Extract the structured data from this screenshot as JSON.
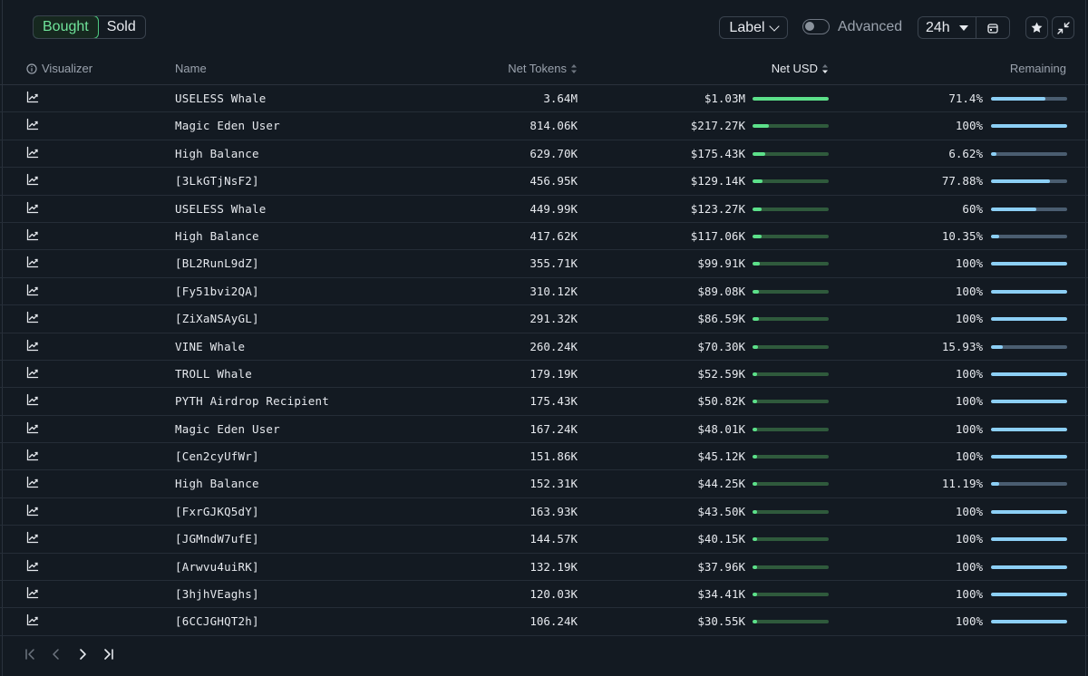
{
  "toolbar": {
    "tabs": [
      {
        "label": "Bought",
        "active": true
      },
      {
        "label": "Sold",
        "active": false
      }
    ],
    "label_dropdown": "Label",
    "advanced_label": "Advanced",
    "advanced_enabled": false,
    "time_range": "24h",
    "icons": [
      "calendar-icon",
      "star-icon",
      "collapse-icon"
    ]
  },
  "table": {
    "columns": {
      "visualizer": "Visualizer",
      "name": "Name",
      "net_tokens": "Net Tokens",
      "net_usd": "Net USD",
      "remaining": "Remaining"
    },
    "rows": [
      {
        "name": "USELESS Whale",
        "net_tokens": "3.64M",
        "net_usd": "$1.03M",
        "usd_fraction": 1.0,
        "remaining": "71.4%",
        "remaining_fraction": 0.714
      },
      {
        "name": "Magic Eden User",
        "net_tokens": "814.06K",
        "net_usd": "$217.27K",
        "usd_fraction": 0.211,
        "remaining": "100%",
        "remaining_fraction": 1.0
      },
      {
        "name": "High Balance",
        "net_tokens": "629.70K",
        "net_usd": "$175.43K",
        "usd_fraction": 0.17,
        "remaining": "6.62%",
        "remaining_fraction": 0.0662
      },
      {
        "name": "[3LkGTjNsF2]",
        "net_tokens": "456.95K",
        "net_usd": "$129.14K",
        "usd_fraction": 0.125,
        "remaining": "77.88%",
        "remaining_fraction": 0.7788
      },
      {
        "name": "USELESS Whale",
        "net_tokens": "449.99K",
        "net_usd": "$123.27K",
        "usd_fraction": 0.12,
        "remaining": "60%",
        "remaining_fraction": 0.6
      },
      {
        "name": "High Balance",
        "net_tokens": "417.62K",
        "net_usd": "$117.06K",
        "usd_fraction": 0.114,
        "remaining": "10.35%",
        "remaining_fraction": 0.1035
      },
      {
        "name": "[BL2RunL9dZ]",
        "net_tokens": "355.71K",
        "net_usd": "$99.91K",
        "usd_fraction": 0.097,
        "remaining": "100%",
        "remaining_fraction": 1.0
      },
      {
        "name": "[Fy51bvi2QA]",
        "net_tokens": "310.12K",
        "net_usd": "$89.08K",
        "usd_fraction": 0.086,
        "remaining": "100%",
        "remaining_fraction": 1.0
      },
      {
        "name": "[ZiXaNSAyGL]",
        "net_tokens": "291.32K",
        "net_usd": "$86.59K",
        "usd_fraction": 0.084,
        "remaining": "100%",
        "remaining_fraction": 1.0
      },
      {
        "name": "VINE Whale",
        "net_tokens": "260.24K",
        "net_usd": "$70.30K",
        "usd_fraction": 0.068,
        "remaining": "15.93%",
        "remaining_fraction": 0.1593
      },
      {
        "name": "TROLL Whale",
        "net_tokens": "179.19K",
        "net_usd": "$52.59K",
        "usd_fraction": 0.051,
        "remaining": "100%",
        "remaining_fraction": 1.0
      },
      {
        "name": "PYTH Airdrop Recipient",
        "net_tokens": "175.43K",
        "net_usd": "$50.82K",
        "usd_fraction": 0.049,
        "remaining": "100%",
        "remaining_fraction": 1.0
      },
      {
        "name": "Magic Eden User",
        "net_tokens": "167.24K",
        "net_usd": "$48.01K",
        "usd_fraction": 0.047,
        "remaining": "100%",
        "remaining_fraction": 1.0
      },
      {
        "name": "[Cen2cyUfWr]",
        "net_tokens": "151.86K",
        "net_usd": "$45.12K",
        "usd_fraction": 0.044,
        "remaining": "100%",
        "remaining_fraction": 1.0
      },
      {
        "name": "High Balance",
        "net_tokens": "152.31K",
        "net_usd": "$44.25K",
        "usd_fraction": 0.043,
        "remaining": "11.19%",
        "remaining_fraction": 0.1119
      },
      {
        "name": "[FxrGJKQ5dY]",
        "net_tokens": "163.93K",
        "net_usd": "$43.50K",
        "usd_fraction": 0.042,
        "remaining": "100%",
        "remaining_fraction": 1.0
      },
      {
        "name": "[JGMndW7ufE]",
        "net_tokens": "144.57K",
        "net_usd": "$40.15K",
        "usd_fraction": 0.039,
        "remaining": "100%",
        "remaining_fraction": 1.0
      },
      {
        "name": "[Arwvu4uiRK]",
        "net_tokens": "132.19K",
        "net_usd": "$37.96K",
        "usd_fraction": 0.037,
        "remaining": "100%",
        "remaining_fraction": 1.0
      },
      {
        "name": "[3hjhVEaghs]",
        "net_tokens": "120.03K",
        "net_usd": "$34.41K",
        "usd_fraction": 0.033,
        "remaining": "100%",
        "remaining_fraction": 1.0
      },
      {
        "name": "[6CCJGHQT2h]",
        "net_tokens": "106.24K",
        "net_usd": "$30.55K",
        "usd_fraction": 0.03,
        "remaining": "100%",
        "remaining_fraction": 1.0
      }
    ]
  },
  "pagination": {
    "icons": [
      "first-page-icon",
      "prev-page-icon",
      "next-page-icon",
      "last-page-icon"
    ]
  },
  "colors": {
    "background": "#131a22",
    "accent_green": "#5ce08a",
    "remaining_blue": "#8ccff5"
  }
}
